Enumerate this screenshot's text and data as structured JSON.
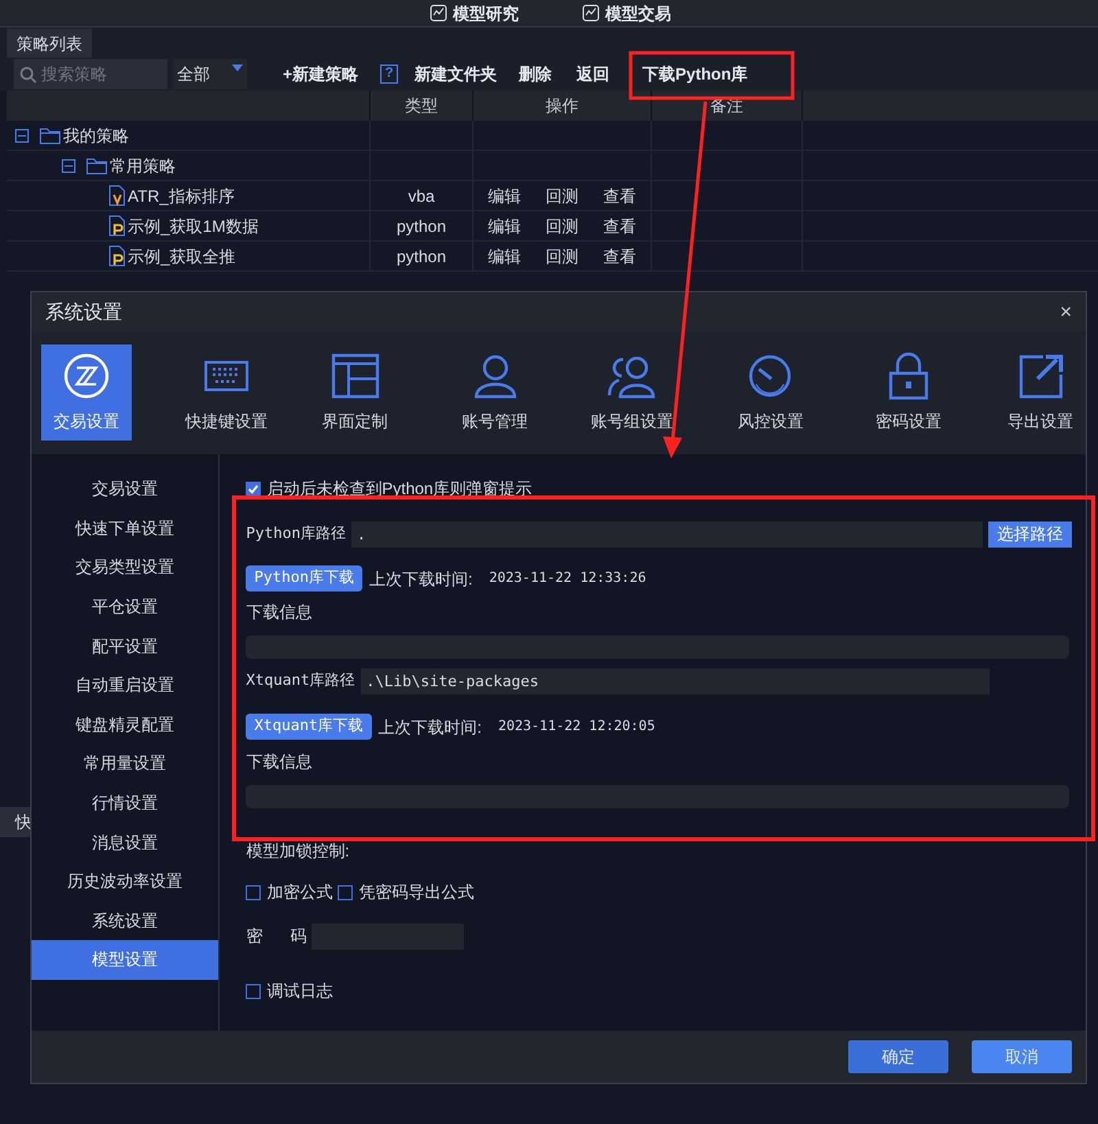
{
  "top_tabs": [
    {
      "label": "模型研究"
    },
    {
      "label": "模型交易"
    }
  ],
  "panel_tab": "策略列表",
  "toolbar": {
    "search_placeholder": "搜索策略",
    "filter": "全部",
    "buttons": [
      {
        "kind": "text",
        "label": "+新建策略"
      },
      {
        "kind": "help",
        "label": "?"
      },
      {
        "kind": "text",
        "label": "新建文件夹"
      },
      {
        "kind": "text",
        "label": "删除"
      },
      {
        "kind": "text",
        "label": "返回"
      },
      {
        "kind": "text",
        "label": "下载Python库"
      }
    ]
  },
  "table": {
    "columns": [
      "类型",
      "操作",
      "备注"
    ],
    "tree": [
      {
        "kind": "folder",
        "label": "我的策略",
        "expanded": true,
        "children": [
          {
            "kind": "folder",
            "label": "常用策略",
            "expanded": true,
            "children": [
              {
                "kind": "vba_file",
                "label": "ATR_指标排序",
                "type": "vba",
                "actions": [
                  "编辑",
                  "回测",
                  "查看"
                ]
              },
              {
                "kind": "python_file",
                "label": "示例_获取1M数据",
                "type": "python",
                "actions": [
                  "编辑",
                  "回测",
                  "查看"
                ]
              },
              {
                "kind": "python_file",
                "label": "示例_获取全推",
                "type": "python",
                "actions": [
                  "编辑",
                  "回测",
                  "查看"
                ]
              }
            ]
          }
        ]
      }
    ]
  },
  "background_fragment": "快",
  "dialog": {
    "title": "系统设置",
    "close": "×",
    "categories": [
      {
        "label": "交易设置",
        "selected": true
      },
      {
        "label": "快捷键设置",
        "selected": false
      },
      {
        "label": "界面定制",
        "selected": false
      },
      {
        "label": "账号管理",
        "selected": false
      },
      {
        "label": "账号组设置",
        "selected": false
      },
      {
        "label": "风控设置",
        "selected": false
      },
      {
        "label": "密码设置",
        "selected": false
      },
      {
        "label": "导出设置",
        "selected": false
      }
    ],
    "sidebar": [
      {
        "label": "交易设置",
        "selected": false
      },
      {
        "label": "快速下单设置",
        "selected": false
      },
      {
        "label": "交易类型设置",
        "selected": false
      },
      {
        "label": "平仓设置",
        "selected": false
      },
      {
        "label": "配平设置",
        "selected": false
      },
      {
        "label": "自动重启设置",
        "selected": false
      },
      {
        "label": "键盘精灵配置",
        "selected": false
      },
      {
        "label": "常用量设置",
        "selected": false
      },
      {
        "label": "行情设置",
        "selected": false
      },
      {
        "label": "消息设置",
        "selected": false
      },
      {
        "label": "历史波动率设置",
        "selected": false
      },
      {
        "label": "系统设置",
        "selected": false
      },
      {
        "label": "模型设置",
        "selected": true
      }
    ],
    "startup_prompt": {
      "label": "启动后未检查到Python库则弹窗提示",
      "checked": true
    },
    "libraries": [
      {
        "path_label": "Python库路径",
        "path_value": ".",
        "choose_button": "选择路径",
        "download_button": "Python库下载",
        "last_label": "上次下载时间:",
        "last_time": "2023-11-22 12:33:26",
        "info_label": "下载信息"
      },
      {
        "path_label": "Xtquant库路径",
        "path_value": ".\\Lib\\site-packages",
        "download_button": "Xtquant库下载",
        "last_label": "上次下载时间:",
        "last_time": "2023-11-22 12:20:05",
        "info_label": "下载信息"
      }
    ],
    "lock_label": "模型加锁控制:",
    "lock_options": [
      {
        "label": "加密公式",
        "checked": false
      },
      {
        "label": "凭密码导出公式",
        "checked": false
      }
    ],
    "password_label": [
      "密",
      "码"
    ],
    "debug_log": {
      "label": "调试日志",
      "checked": false
    },
    "buttons": [
      {
        "label": "确定",
        "kind": "primary"
      },
      {
        "label": "取消",
        "kind": "secondary"
      }
    ]
  }
}
